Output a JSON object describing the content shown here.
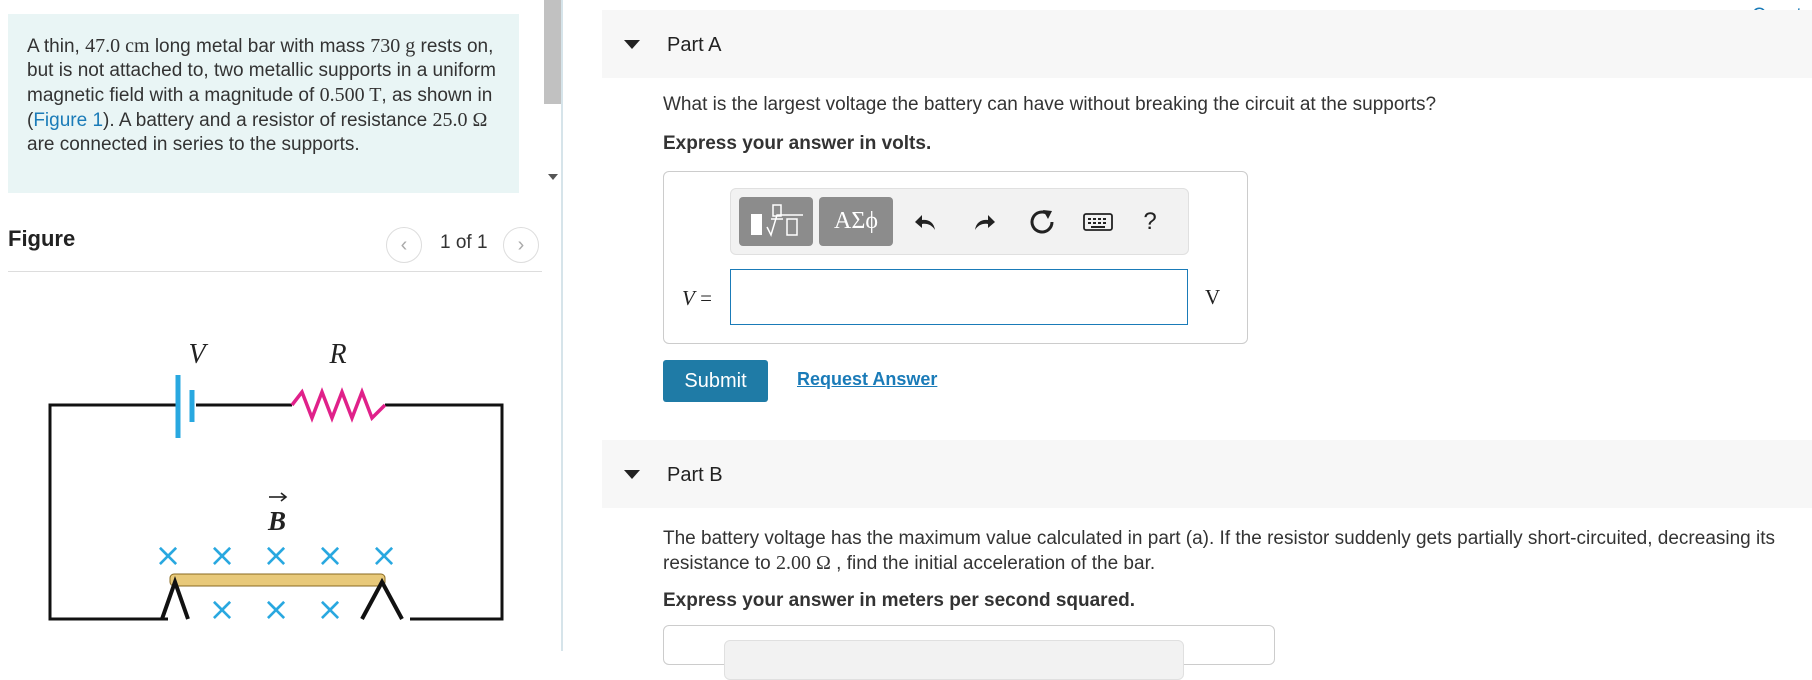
{
  "problem": {
    "p1": "A thin, ",
    "length": "47.0 cm",
    "p2": " long metal bar with mass ",
    "mass": "730 g",
    "p3": " rests on, but is not attached to, two metallic supports in a uniform magnetic field with a magnitude of ",
    "field": "0.500 T",
    "p4": ", as shown in (",
    "figure_link": "Figure 1",
    "p5": "). A battery and a resistor of resistance ",
    "resistance": "25.0 Ω",
    "p6": " are connected in series to the supports."
  },
  "figure": {
    "title": "Figure",
    "pager": "1 of 1",
    "prev_glyph": "‹",
    "next_glyph": "›",
    "label_v": "V",
    "label_r": "R",
    "label_b": "B",
    "cross": "×"
  },
  "header_link": "Consta",
  "part_a": {
    "title": "Part A",
    "question": "What is the largest voltage the battery can have without breaking the circuit at the supports?",
    "instruction": "Express your answer in volts.",
    "var_name": "V",
    "var_equals": " =",
    "unit": "V",
    "input_value": "",
    "toolbar": {
      "greek": "ΑΣϕ",
      "help": "?"
    },
    "submit": "Submit",
    "request_answer": "Request Answer"
  },
  "part_b": {
    "title": "Part B",
    "q1": "The battery voltage has the maximum value calculated in part (a). If the resistor suddenly gets partially short-circuited, decreasing its resistance to ",
    "resistance": "2.00 Ω",
    "q2": " , find the initial acceleration of the bar.",
    "instruction": "Express your answer in meters per second squared."
  },
  "colors": {
    "accent": "#1a7bb8",
    "submit_bg": "#1f7ba6",
    "problem_bg": "#e9f5f5",
    "battery": "#29a8e0",
    "resistor": "#e0218a",
    "field_cross": "#29a8e0",
    "bar": "#e8c97a"
  }
}
